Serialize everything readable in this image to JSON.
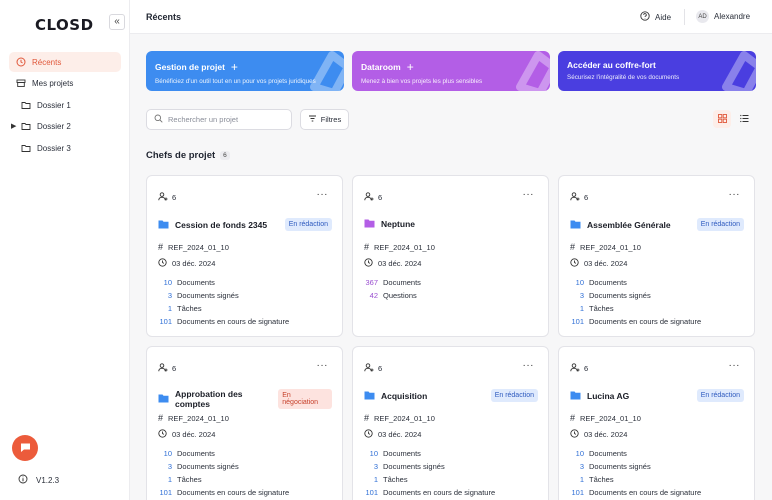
{
  "app": {
    "logo": "CLOSD",
    "version": "V1.2.3"
  },
  "sidebar": {
    "items": [
      {
        "label": "Récents",
        "active": true,
        "icon": "clock-icon"
      },
      {
        "label": "Mes projets",
        "icon": "box-icon"
      },
      {
        "label": "Dossier 1",
        "icon": "folder-icon"
      },
      {
        "label": "Dossier 2",
        "icon": "folder-icon",
        "expandable": true
      },
      {
        "label": "Dossier 3",
        "icon": "folder-icon"
      }
    ]
  },
  "header": {
    "title": "Récents",
    "help": "Aide",
    "user_initials": "AD",
    "user_name": "Alexandre"
  },
  "banners": [
    {
      "title": "Gestion de projet",
      "subtitle": "Bénéficiez d'un outil tout en un pour vos projets juridiques",
      "color": "#3d8cf0"
    },
    {
      "title": "Dataroom",
      "subtitle": "Menez à bien vos projets les plus sensibles",
      "color": "#b35ee6"
    },
    {
      "title": "Accéder au coffre-fort",
      "subtitle": "Sécurisez l'intégralité de vos documents",
      "color": "#4a3ee0"
    }
  ],
  "search": {
    "placeholder": "Rechercher un projet"
  },
  "filter_label": "Filtres",
  "section": {
    "title": "Chefs de projet",
    "count": "6"
  },
  "cards": [
    {
      "members": "6",
      "title": "Cession de fonds 2345",
      "status": "En rédaction",
      "status_type": "redac",
      "ref": "REF_2024_01_10",
      "date": "03 déc. 2024",
      "stats": [
        {
          "n": "10",
          "l": "Documents"
        },
        {
          "n": "3",
          "l": "Documents signés"
        },
        {
          "n": "1",
          "l": "Tâches"
        },
        {
          "n": "101",
          "l": "Documents en cours de signature"
        }
      ],
      "folder_color": "#3d8cf0"
    },
    {
      "members": "6",
      "title": "Neptune",
      "status": "",
      "status_type": "",
      "ref": "REF_2024_01_10",
      "date": "03 déc. 2024",
      "stats": [
        {
          "n": "367",
          "l": "Documents"
        },
        {
          "n": "42",
          "l": "Questions"
        }
      ],
      "folder_color": "#b35ee6",
      "purple": true
    },
    {
      "members": "6",
      "title": "Assemblée Générale",
      "status": "En rédaction",
      "status_type": "redac",
      "ref": "REF_2024_01_10",
      "date": "03 déc. 2024",
      "stats": [
        {
          "n": "10",
          "l": "Documents"
        },
        {
          "n": "3",
          "l": "Documents signés"
        },
        {
          "n": "1",
          "l": "Tâches"
        },
        {
          "n": "101",
          "l": "Documents en cours de signature"
        }
      ],
      "folder_color": "#3d8cf0"
    },
    {
      "members": "6",
      "title": "Approbation des comptes",
      "status": "En négociation",
      "status_type": "nego",
      "ref": "REF_2024_01_10",
      "date": "03 déc. 2024",
      "stats": [
        {
          "n": "10",
          "l": "Documents"
        },
        {
          "n": "3",
          "l": "Documents signés"
        },
        {
          "n": "1",
          "l": "Tâches"
        },
        {
          "n": "101",
          "l": "Documents en cours de signature"
        }
      ],
      "folder_color": "#3d8cf0"
    },
    {
      "members": "6",
      "title": "Acquisition",
      "status": "En rédaction",
      "status_type": "redac",
      "ref": "REF_2024_01_10",
      "date": "03 déc. 2024",
      "stats": [
        {
          "n": "10",
          "l": "Documents"
        },
        {
          "n": "3",
          "l": "Documents signés"
        },
        {
          "n": "1",
          "l": "Tâches"
        },
        {
          "n": "101",
          "l": "Documents en cours de signature"
        }
      ],
      "folder_color": "#3d8cf0"
    },
    {
      "members": "6",
      "title": "Lucina AG",
      "status": "En rédaction",
      "status_type": "redac",
      "ref": "REF_2024_01_10",
      "date": "03 déc. 2024",
      "stats": [
        {
          "n": "10",
          "l": "Documents"
        },
        {
          "n": "3",
          "l": "Documents signés"
        },
        {
          "n": "1",
          "l": "Tâches"
        },
        {
          "n": "101",
          "l": "Documents en cours de signature"
        }
      ],
      "folder_color": "#3d8cf0"
    }
  ]
}
